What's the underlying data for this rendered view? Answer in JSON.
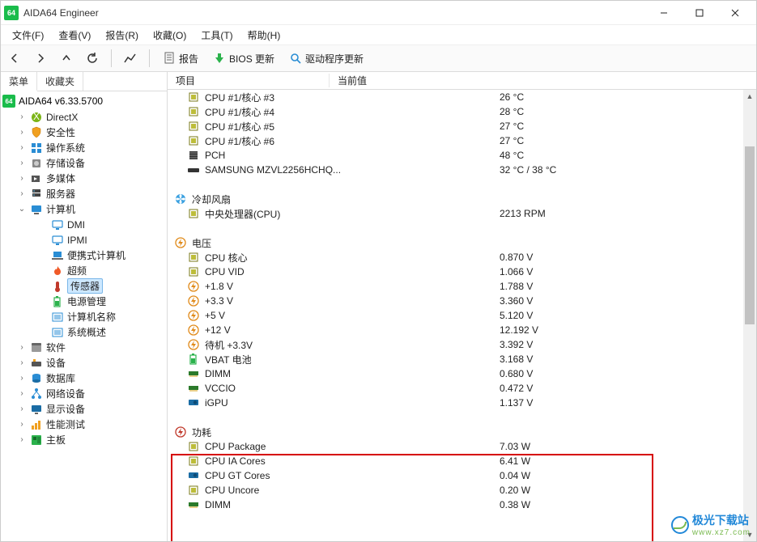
{
  "window": {
    "title": "AIDA64 Engineer",
    "badge": "64"
  },
  "menubar": [
    "文件(F)",
    "查看(V)",
    "报告(R)",
    "收藏(O)",
    "工具(T)",
    "帮助(H)"
  ],
  "toolbar": {
    "report": "报告",
    "bios": "BIOS 更新",
    "driver": "驱动程序更新"
  },
  "sidebar": {
    "tabs": [
      "菜单",
      "收藏夹"
    ],
    "root": "AIDA64 v6.33.5700",
    "items": [
      {
        "label": "DirectX",
        "depth": 1,
        "twisty": ">",
        "icon": "directx"
      },
      {
        "label": "安全性",
        "depth": 1,
        "twisty": ">",
        "icon": "shield"
      },
      {
        "label": "操作系统",
        "depth": 1,
        "twisty": ">",
        "icon": "os"
      },
      {
        "label": "存储设备",
        "depth": 1,
        "twisty": ">",
        "icon": "storage"
      },
      {
        "label": "多媒体",
        "depth": 1,
        "twisty": ">",
        "icon": "media"
      },
      {
        "label": "服务器",
        "depth": 1,
        "twisty": ">",
        "icon": "server"
      },
      {
        "label": "计算机",
        "depth": 1,
        "twisty": "v",
        "icon": "computer"
      },
      {
        "label": "DMI",
        "depth": 2,
        "twisty": "",
        "icon": "monitor"
      },
      {
        "label": "IPMI",
        "depth": 2,
        "twisty": "",
        "icon": "monitor"
      },
      {
        "label": "便携式计算机",
        "depth": 2,
        "twisty": "",
        "icon": "laptop"
      },
      {
        "label": "超频",
        "depth": 2,
        "twisty": "",
        "icon": "flame"
      },
      {
        "label": "传感器",
        "depth": 2,
        "twisty": "",
        "icon": "sensor",
        "selected": true
      },
      {
        "label": "电源管理",
        "depth": 2,
        "twisty": "",
        "icon": "battery"
      },
      {
        "label": "计算机名称",
        "depth": 2,
        "twisty": "",
        "icon": "list"
      },
      {
        "label": "系统概述",
        "depth": 2,
        "twisty": "",
        "icon": "list"
      },
      {
        "label": "软件",
        "depth": 1,
        "twisty": ">",
        "icon": "software"
      },
      {
        "label": "设备",
        "depth": 1,
        "twisty": ">",
        "icon": "device"
      },
      {
        "label": "数据库",
        "depth": 1,
        "twisty": ">",
        "icon": "database"
      },
      {
        "label": "网络设备",
        "depth": 1,
        "twisty": ">",
        "icon": "network"
      },
      {
        "label": "显示设备",
        "depth": 1,
        "twisty": ">",
        "icon": "display"
      },
      {
        "label": "性能测试",
        "depth": 1,
        "twisty": ">",
        "icon": "bench"
      },
      {
        "label": "主板",
        "depth": 1,
        "twisty": ">",
        "icon": "mobo"
      }
    ]
  },
  "columns": {
    "item": "项目",
    "value": "当前值"
  },
  "rows": [
    {
      "type": "data",
      "icon": "chip",
      "label": "CPU #1/核心 #3",
      "value": "26 °C"
    },
    {
      "type": "data",
      "icon": "chip",
      "label": "CPU #1/核心 #4",
      "value": "28 °C"
    },
    {
      "type": "data",
      "icon": "chip",
      "label": "CPU #1/核心 #5",
      "value": "27 °C"
    },
    {
      "type": "data",
      "icon": "chip",
      "label": "CPU #1/核心 #6",
      "value": "27 °C"
    },
    {
      "type": "data",
      "icon": "pch",
      "label": "PCH",
      "value": "48 °C"
    },
    {
      "type": "data",
      "icon": "ssd",
      "label": "SAMSUNG MZVL2256HCHQ...",
      "value": "32 °C / 38 °C"
    },
    {
      "type": "gap"
    },
    {
      "type": "header",
      "icon": "fan",
      "label": "冷却风扇"
    },
    {
      "type": "data",
      "icon": "chip",
      "label": "中央处理器(CPU)",
      "value": "2213 RPM"
    },
    {
      "type": "gap"
    },
    {
      "type": "header",
      "icon": "volt",
      "label": "电压"
    },
    {
      "type": "data",
      "icon": "chip",
      "label": "CPU 核心",
      "value": "0.870 V"
    },
    {
      "type": "data",
      "icon": "chip",
      "label": "CPU VID",
      "value": "1.066 V"
    },
    {
      "type": "data",
      "icon": "volt",
      "label": "+1.8 V",
      "value": "1.788 V"
    },
    {
      "type": "data",
      "icon": "volt",
      "label": "+3.3 V",
      "value": "3.360 V"
    },
    {
      "type": "data",
      "icon": "volt",
      "label": "+5 V",
      "value": "5.120 V"
    },
    {
      "type": "data",
      "icon": "volt",
      "label": "+12 V",
      "value": "12.192 V"
    },
    {
      "type": "data",
      "icon": "volt",
      "label": "待机 +3.3V",
      "value": "3.392 V"
    },
    {
      "type": "data",
      "icon": "battery",
      "label": "VBAT 电池",
      "value": "3.168 V"
    },
    {
      "type": "data",
      "icon": "ram",
      "label": "DIMM",
      "value": "0.680 V"
    },
    {
      "type": "data",
      "icon": "ram",
      "label": "VCCIO",
      "value": "0.472 V"
    },
    {
      "type": "data",
      "icon": "gpu",
      "label": "iGPU",
      "value": "1.137 V"
    },
    {
      "type": "gap"
    },
    {
      "type": "header",
      "icon": "power",
      "label": "功耗"
    },
    {
      "type": "data",
      "icon": "chip",
      "label": "CPU Package",
      "value": "7.03 W"
    },
    {
      "type": "data",
      "icon": "chip",
      "label": "CPU IA Cores",
      "value": "6.41 W"
    },
    {
      "type": "data",
      "icon": "gpu",
      "label": "CPU GT Cores",
      "value": "0.04 W"
    },
    {
      "type": "data",
      "icon": "chip",
      "label": "CPU Uncore",
      "value": "0.20 W"
    },
    {
      "type": "data",
      "icon": "ram",
      "label": "DIMM",
      "value": "0.38 W"
    }
  ],
  "watermark": {
    "name": "极光下载站",
    "url": "www.xz7.com"
  }
}
